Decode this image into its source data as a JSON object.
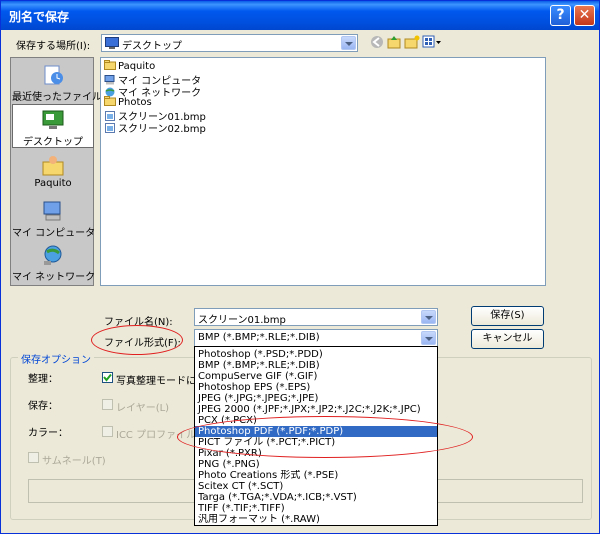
{
  "window": {
    "title": "別名で保存",
    "help_glyph": "?",
    "close_glyph": "✕",
    "colors": {
      "titlebar": "#0050e0",
      "accent_red": "#e02020",
      "selection": "#316ac5"
    }
  },
  "save_in": {
    "label": "保存する場所(I):",
    "value": "デスクトップ"
  },
  "places": [
    {
      "label": "最近使ったファイル",
      "icon": "recent-files-icon"
    },
    {
      "label": "デスクトップ",
      "icon": "desktop-icon"
    },
    {
      "label": "Paquito",
      "icon": "user-folder-icon"
    },
    {
      "label": "マイ コンピュータ",
      "icon": "my-computer-icon"
    },
    {
      "label": "マイ ネットワーク",
      "icon": "my-network-icon"
    }
  ],
  "files": [
    {
      "name": "Paquito",
      "icon": "folder-icon"
    },
    {
      "name": "マイ コンピュータ",
      "icon": "computer-icon"
    },
    {
      "name": "マイ ネットワーク",
      "icon": "network-icon"
    },
    {
      "name": "Photos",
      "icon": "folder-icon"
    },
    {
      "name": "スクリーン01.bmp",
      "icon": "bmp-file-icon"
    },
    {
      "name": "スクリーン02.bmp",
      "icon": "bmp-file-icon"
    }
  ],
  "file_name": {
    "label": "ファイル名(N):",
    "value": "スクリーン01.bmp"
  },
  "file_type": {
    "label": "ファイル形式(F):",
    "value": "BMP (*.BMP;*.RLE;*.DIB)"
  },
  "buttons": {
    "save": "保存(S)",
    "cancel": "キャンセル"
  },
  "options": {
    "group_title": "保存オプション",
    "organize_label": "整理：",
    "organize_checkbox": "写真整理モードに含め",
    "save_label": "保存：",
    "layers": "レイヤー(L)",
    "color_label": "カラー：",
    "icc": "ICC プロファイル",
    "thumbnail": "サムネール(T)"
  },
  "file_types": [
    "Photoshop (*.PSD;*.PDD)",
    "BMP (*.BMP;*.RLE;*.DIB)",
    "CompuServe GIF (*.GIF)",
    "Photoshop EPS (*.EPS)",
    "JPEG (*.JPG;*.JPEG;*.JPE)",
    "JPEG 2000 (*.JPF;*.JPX;*.JP2;*.J2C;*.J2K;*.JPC)",
    "PCX (*.PCX)",
    "Photoshop PDF (*.PDF;*.PDP)",
    "PICT ファイル (*.PCT;*.PICT)",
    "Pixar (*.PXR)",
    "PNG (*.PNG)",
    "Photo Creations 形式 (*.PSE)",
    "Scitex CT (*.SCT)",
    "Targa (*.TGA;*.VDA;*.ICB;*.VST)",
    "TIFF (*.TIF;*.TIFF)",
    "汎用フォーマット (*.RAW)"
  ],
  "selected_file_type": "Photoshop PDF (*.PDF;*.PDP)"
}
